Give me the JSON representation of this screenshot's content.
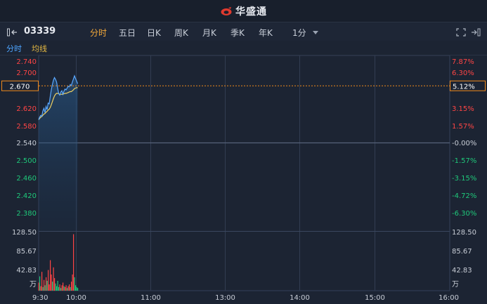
{
  "header": {
    "brand": "华盛通"
  },
  "toolbar": {
    "stock_code": "03339",
    "periods": [
      {
        "label": "分时",
        "active": true
      },
      {
        "label": "五日",
        "active": false
      },
      {
        "label": "日K",
        "active": false
      },
      {
        "label": "周K",
        "active": false
      },
      {
        "label": "月K",
        "active": false
      },
      {
        "label": "季K",
        "active": false
      },
      {
        "label": "年K",
        "active": false
      }
    ],
    "minute_select": "1分"
  },
  "subtabs": {
    "fenshi": "分时",
    "junxian": "均线"
  },
  "colors": {
    "background": "#1c2433",
    "price_line": "#5aa8ff",
    "avg_line": "#f0d060",
    "up": "#ff4545",
    "down": "#1fc87a",
    "crosshair": "#f08a1c",
    "neutral": "#c8cdd6"
  },
  "chart_data": {
    "type": "line",
    "prev_close": 2.54,
    "price_axis": {
      "labels": [
        "2.740",
        "2.700",
        "2.670",
        "2.620",
        "2.580",
        "2.540",
        "2.500",
        "2.460",
        "2.420",
        "2.380"
      ],
      "pct_labels": [
        "7.87%",
        "6.30%",
        "5.12%",
        "3.15%",
        "1.57%",
        "-0.00%",
        "-1.57%",
        "-3.15%",
        "-4.72%",
        "-6.30%"
      ]
    },
    "crosshair": {
      "price": "2.670",
      "pct": "5.12%"
    },
    "volume_axis": {
      "labels": [
        "128.50",
        "85.67",
        "42.83"
      ],
      "unit": "万",
      "max": 128.5
    },
    "time_labels": [
      "9:30",
      "10:00",
      "11:00",
      "13:00",
      "14:00",
      "15:00",
      "16:00"
    ],
    "price_series": [
      2.592,
      2.598,
      2.602,
      2.6,
      2.612,
      2.618,
      2.608,
      2.622,
      2.615,
      2.63,
      2.628,
      2.645,
      2.66,
      2.672,
      2.682,
      2.688,
      2.684,
      2.678,
      2.664,
      2.652,
      2.648,
      2.655,
      2.658,
      2.65,
      2.657,
      2.662,
      2.66,
      2.664,
      2.668,
      2.667,
      2.672,
      2.67,
      2.678,
      2.685,
      2.692,
      2.686,
      2.68,
      2.674
    ],
    "avg_series": [
      2.592,
      2.595,
      2.598,
      2.599,
      2.602,
      2.605,
      2.606,
      2.609,
      2.611,
      2.614,
      2.616,
      2.62,
      2.626,
      2.633,
      2.64,
      2.646,
      2.65,
      2.652,
      2.652,
      2.651,
      2.65,
      2.65,
      2.65,
      2.65,
      2.651,
      2.652,
      2.652,
      2.653,
      2.654,
      2.655,
      2.656,
      2.656,
      2.658,
      2.66,
      2.663,
      2.664,
      2.665,
      2.665
    ],
    "volume_series": [
      18,
      32,
      10,
      42,
      8,
      24,
      12,
      30,
      22,
      46,
      14,
      68,
      36,
      20,
      52,
      28,
      16,
      10,
      22,
      8,
      14,
      6,
      12,
      18,
      10,
      8,
      12,
      6,
      10,
      14,
      8,
      20,
      36,
      126,
      30,
      12,
      8,
      6
    ],
    "volume_up": [
      true,
      false,
      true,
      true,
      false,
      true,
      false,
      true,
      false,
      true,
      true,
      true,
      true,
      false,
      true,
      true,
      false,
      false,
      false,
      false,
      true,
      false,
      true,
      true,
      false,
      true,
      true,
      false,
      true,
      true,
      false,
      true,
      true,
      true,
      false,
      false,
      false,
      false
    ]
  }
}
